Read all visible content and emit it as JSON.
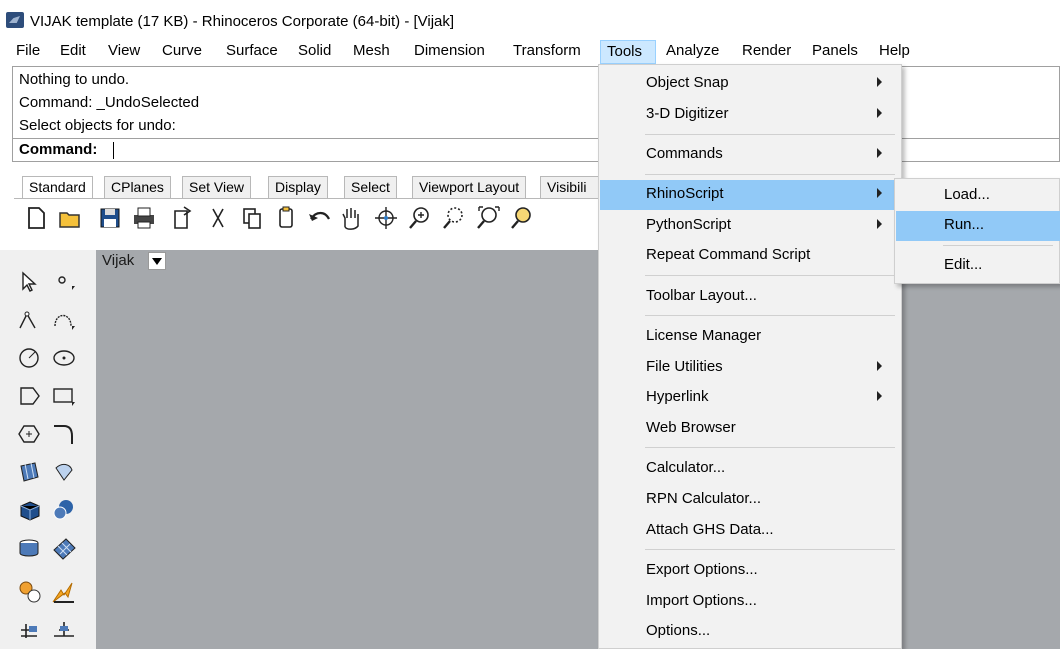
{
  "window": {
    "title": "VIJAK template (17 KB) - Rhinoceros Corporate (64-bit) - [Vijak]"
  },
  "menubar": [
    "File",
    "Edit",
    "View",
    "Curve",
    "Surface",
    "Solid",
    "Mesh",
    "Dimension",
    "Transform",
    "Tools",
    "Analyze",
    "Render",
    "Panels",
    "Help"
  ],
  "command_area": {
    "history": [
      "Nothing to undo.",
      "Command: _UndoSelected",
      "Select objects for undo:"
    ],
    "prompt": "Command:"
  },
  "toolbar_tabs": [
    "Standard",
    "CPlanes",
    "Set View",
    "Display",
    "Select",
    "Viewport Layout",
    "Visibili"
  ],
  "toolbar_icons": [
    "new-file-icon",
    "open-folder-icon",
    "save-icon",
    "print-icon",
    "import-icon",
    "cut-icon",
    "copy-icon",
    "paste-icon",
    "undo-icon",
    "pan-hand-icon",
    "rotate-view-icon",
    "zoom-in-icon",
    "zoom-window-icon",
    "zoom-extents-icon",
    "zoom-selected-icon"
  ],
  "palette_icons": [
    "select-arrow-icon",
    "point-icon",
    "polyline-icon",
    "curve-icon",
    "circle-icon",
    "ellipse-icon",
    "arc-icon",
    "rectangle-icon",
    "polygon-icon",
    "fillet-icon",
    "surface-icon",
    "loft-icon",
    "box-icon",
    "sphere-icon",
    "extrude-icon",
    "mesh-icon",
    "gears-icon",
    "explode-icon",
    "dimension-icon",
    "align-icon"
  ],
  "viewport": {
    "title": "Vijak"
  },
  "tools_menu": {
    "items": [
      {
        "label": "Object Snap",
        "submenu": true
      },
      {
        "label": "3-D Digitizer",
        "submenu": true
      },
      {
        "label": "Commands",
        "submenu": true
      },
      {
        "label": "RhinoScript",
        "submenu": true,
        "highlighted": true
      },
      {
        "label": "PythonScript",
        "submenu": true
      },
      {
        "label": "Repeat Command Script",
        "submenu": false
      },
      {
        "label": "Toolbar Layout...",
        "submenu": false
      },
      {
        "label": "License Manager",
        "submenu": false
      },
      {
        "label": "File Utilities",
        "submenu": true
      },
      {
        "label": "Hyperlink",
        "submenu": true
      },
      {
        "label": "Web Browser",
        "submenu": false
      },
      {
        "label": "Calculator...",
        "submenu": false
      },
      {
        "label": "RPN Calculator...",
        "submenu": false
      },
      {
        "label": "Attach GHS Data...",
        "submenu": false
      },
      {
        "label": "Export Options...",
        "submenu": false
      },
      {
        "label": "Import Options...",
        "submenu": false
      },
      {
        "label": "Options...",
        "submenu": false
      }
    ]
  },
  "rhinoscript_submenu": {
    "items": [
      {
        "label": "Load...",
        "highlighted": false
      },
      {
        "label": "Run...",
        "highlighted": true
      },
      {
        "label": "Edit...",
        "highlighted": false
      }
    ]
  },
  "colors": {
    "highlight": "#91c9f7",
    "menu_open": "#cce8ff",
    "viewport": "#a5a8ac",
    "menu_bg": "#f2f2f2"
  }
}
